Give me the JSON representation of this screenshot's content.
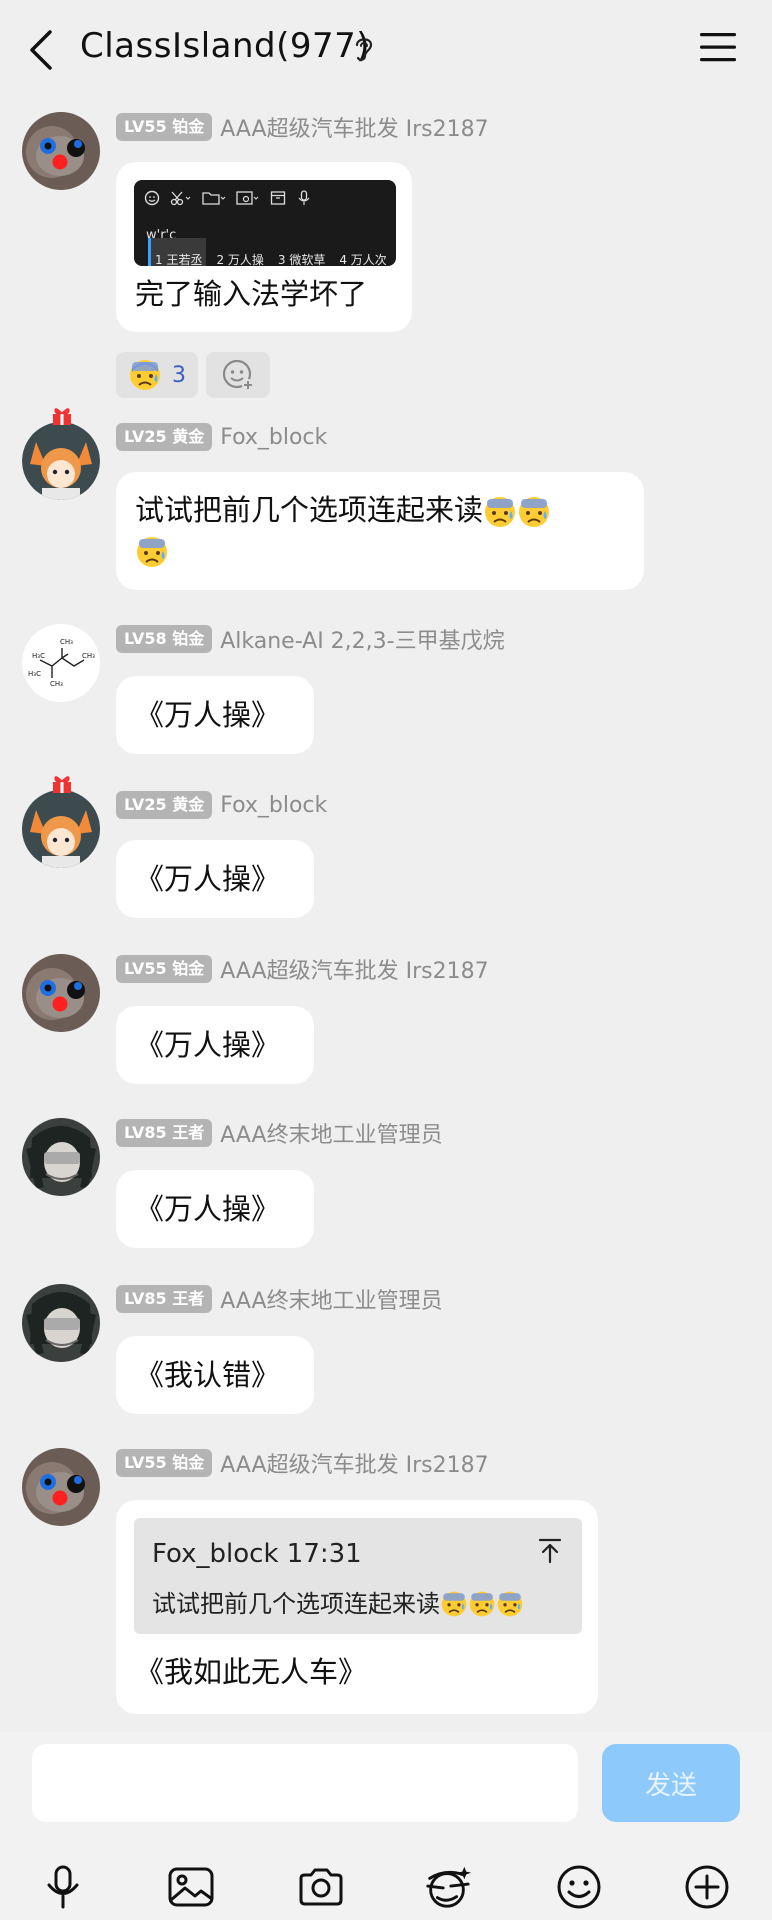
{
  "header": {
    "title": "ClassIsland(977)"
  },
  "messages": [
    {
      "badge": "LV55 铂金",
      "nick": "AAA超级汽车批发 Irs2187",
      "text": "完了输入法学坏了",
      "screenshot": {
        "typed": "w'r'c",
        "candidates": [
          "1 王若丞",
          "2 万人操",
          "3 微软草",
          "4 万人次"
        ]
      },
      "reaction": {
        "emoji": "anxious-face",
        "count": "3"
      }
    },
    {
      "badge": "LV25 黄金",
      "nick": "Fox_block",
      "text": "试试把前几个选项连起来读"
    },
    {
      "badge": "LV58 铂金",
      "nick": "Alkane-AI 2,2,3-三甲基戊烷",
      "text": "《万人操》"
    },
    {
      "badge": "LV25 黄金",
      "nick": "Fox_block",
      "text": "《万人操》"
    },
    {
      "badge": "LV55 铂金",
      "nick": "AAA超级汽车批发 Irs2187",
      "text": "《万人操》"
    },
    {
      "badge": "LV85 王者",
      "nick": "AAA终末地工业管理员",
      "text": "《万人操》"
    },
    {
      "badge": "LV85 王者",
      "nick": "AAA终末地工业管理员",
      "text": "《我认错》"
    },
    {
      "badge": "LV55 铂金",
      "nick": "AAA超级汽车批发 Irs2187",
      "quote": {
        "head": "Fox_block 17:31",
        "text": "试试把前几个选项连起来读"
      },
      "text": "《我如此无人车》"
    }
  ],
  "input": {
    "send_label": "发送"
  },
  "toolbar": [
    "mic-icon",
    "image-icon",
    "camera-icon",
    "sticker-icon",
    "emoji-icon",
    "plus-icon"
  ]
}
